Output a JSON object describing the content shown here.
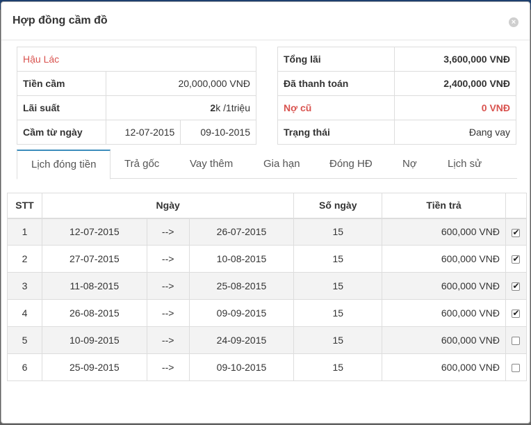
{
  "modal": {
    "title": "Hợp đồng cầm đồ",
    "close_glyph": "×"
  },
  "info_left": {
    "customer": "Hậu Lác",
    "pawn_amount_label": "Tiền cầm",
    "pawn_amount": "20,000,000 VNĐ",
    "interest_label": "Lãi suất",
    "interest_value": "2",
    "interest_unit": "k /1triệu",
    "pawn_from_label": "Cầm từ ngày",
    "pawn_from": "12-07-2015",
    "pawn_to": "09-10-2015"
  },
  "info_right": {
    "total_interest_label": "Tổng lãi",
    "total_interest": "3,600,000 VNĐ",
    "paid_label": "Đã thanh toán",
    "paid": "2,400,000 VNĐ",
    "old_debt_label": "Nợ cũ",
    "old_debt": "0 VNĐ",
    "status_label": "Trạng thái",
    "status": "Đang vay"
  },
  "tabs": [
    {
      "label": "Lịch đóng tiền",
      "active": true
    },
    {
      "label": "Trả gốc"
    },
    {
      "label": "Vay thêm"
    },
    {
      "label": "Gia hạn"
    },
    {
      "label": "Đóng HĐ"
    },
    {
      "label": "Nợ"
    },
    {
      "label": "Lịch sử"
    }
  ],
  "schedule": {
    "headers": {
      "stt": "STT",
      "date": "Ngày",
      "days": "Số ngày",
      "amount": "Tiền trả"
    },
    "arrow": "-->",
    "rows": [
      {
        "stt": "1",
        "from": "12-07-2015",
        "to": "26-07-2015",
        "days": "15",
        "amount": "600,000 VNĐ",
        "checked": true
      },
      {
        "stt": "2",
        "from": "27-07-2015",
        "to": "10-08-2015",
        "days": "15",
        "amount": "600,000 VNĐ",
        "checked": true
      },
      {
        "stt": "3",
        "from": "11-08-2015",
        "to": "25-08-2015",
        "days": "15",
        "amount": "600,000 VNĐ",
        "checked": true
      },
      {
        "stt": "4",
        "from": "26-08-2015",
        "to": "09-09-2015",
        "days": "15",
        "amount": "600,000 VNĐ",
        "checked": true
      },
      {
        "stt": "5",
        "from": "10-09-2015",
        "to": "24-09-2015",
        "days": "15",
        "amount": "600,000 VNĐ",
        "checked": false
      },
      {
        "stt": "6",
        "from": "25-09-2015",
        "to": "09-10-2015",
        "days": "15",
        "amount": "600,000 VNĐ",
        "checked": false
      }
    ]
  },
  "colors": {
    "accent": "#3c8dbc",
    "danger": "#d9534f"
  }
}
